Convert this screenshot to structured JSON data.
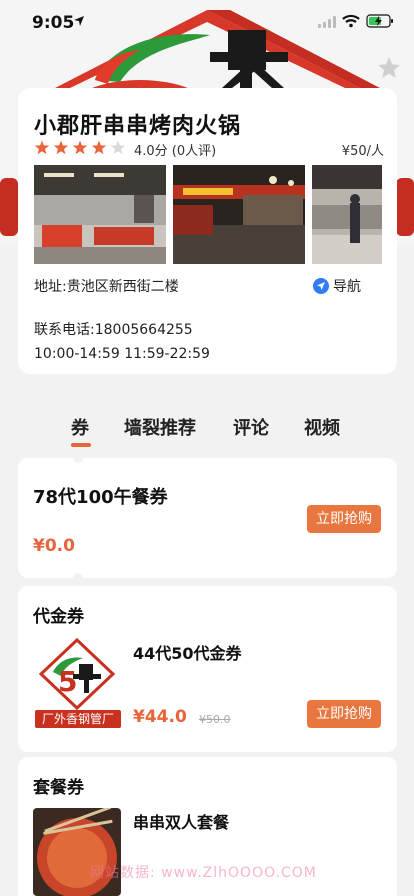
{
  "status_bar": {
    "time": "9:05"
  },
  "shop": {
    "name": "小郡肝串串烤肉火锅",
    "rating_value": 4,
    "rating_max": 5,
    "score_text": "4.0分 (0人评)",
    "price_per_person": "¥50/人",
    "address": "地址:贵池区新西街二楼",
    "nav_label": "导航",
    "phone": "联系电话:18005664255",
    "hours": "10:00-14:59  11:59-22:59"
  },
  "tabs": [
    {
      "label": "券"
    },
    {
      "label": "墙裂推荐"
    },
    {
      "label": "评论"
    },
    {
      "label": "视频"
    }
  ],
  "coupon_main": {
    "title": "78代100午餐券",
    "price": "¥0.0",
    "buy_label": "立即抢购"
  },
  "voucher_section": {
    "title": "代金券",
    "logo_caption": "厂外香钢管厂",
    "item_name": "44代50代金券",
    "price": "¥44.0",
    "original_price": "¥50.0",
    "buy_label": "立即抢购"
  },
  "package_section": {
    "title": "套餐券",
    "item_name": "串串双人套餐"
  },
  "watermark": "网站数据: www.ZlhOOOO.COM",
  "colors": {
    "accent": "#e8643a",
    "button": "#e8763f",
    "star": "#e8643a",
    "logo_red": "#c8311f"
  },
  "icons": {
    "location_arrow": "location-arrow-icon",
    "signal": "signal-icon",
    "wifi": "wifi-icon",
    "battery": "battery-icon",
    "favorite": "star-icon",
    "navigate": "navigate-icon"
  }
}
